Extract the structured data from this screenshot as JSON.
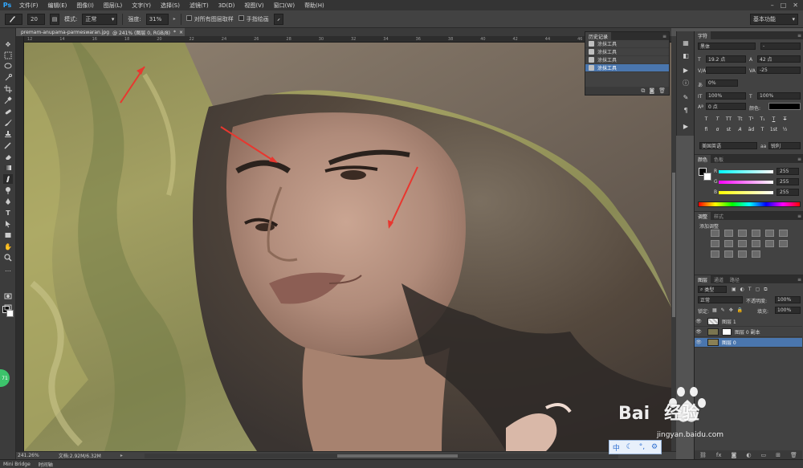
{
  "app": {
    "logo": "Ps"
  },
  "menu": [
    "文件(F)",
    "编辑(E)",
    "图像(I)",
    "图层(L)",
    "文字(Y)",
    "选择(S)",
    "滤镜(T)",
    "3D(D)",
    "视图(V)",
    "窗口(W)",
    "帮助(H)"
  ],
  "options_bar": {
    "size_value": "20",
    "mode_label": "模式:",
    "mode_value": "正常",
    "strength_label": "强度:",
    "strength_value": "31%",
    "sample_all_label": "对所有图层取样",
    "finger_paint_label": "手指绘画",
    "workspace": "基本功能"
  },
  "document": {
    "tab_name": "premam-anupama-parmeswaran.jpg",
    "tab_info": "@ 241% (图层 0, RGB/8)",
    "tab_mark": "*"
  },
  "ruler_ticks": [
    "12",
    "14",
    "16",
    "18",
    "20",
    "22",
    "24",
    "26",
    "28",
    "30",
    "32",
    "34",
    "36",
    "38",
    "40",
    "42",
    "44",
    "46",
    "48",
    "50"
  ],
  "status": {
    "zoom": "241.26%",
    "doc_size": "文档:2.92M/6.32M"
  },
  "bottom_tabs": [
    "Mini Bridge",
    "时间轴"
  ],
  "history_panel": {
    "title": "历史记录",
    "items": [
      "涂抹工具",
      "涂抹工具",
      "涂抹工具",
      "涂抹工具"
    ],
    "active_index": 3
  },
  "character_panel": {
    "tab": "字符",
    "font_family": "黑体",
    "font_style": "-",
    "font_size": "19.2 点",
    "leading": "42 点",
    "kerning_value": "-25",
    "tracking_value": "0%",
    "vscale": "100%",
    "hscale": "100%",
    "baseline": "0 点",
    "color_label": "颜色:",
    "style_glyphs": [
      "T",
      "T",
      "TT",
      "Tt",
      "T¹",
      "T₁",
      "T",
      "T"
    ],
    "extra_glyphs": [
      "fi",
      "σ",
      "st",
      "A",
      "ād",
      "T",
      "1st",
      "½"
    ],
    "language": "美国英语",
    "aa_label": "aa",
    "antialias": "锐利"
  },
  "color_panel": {
    "tabs": [
      "颜色",
      "色板"
    ],
    "channels": [
      {
        "label": "R",
        "value": "255"
      },
      {
        "label": "G",
        "value": "255"
      },
      {
        "label": "B",
        "value": "255"
      }
    ]
  },
  "adjustments_panel": {
    "tabs": [
      "调整",
      "样式"
    ],
    "heading": "添加调整"
  },
  "layers_panel": {
    "tabs": [
      "图层",
      "通道",
      "路径"
    ],
    "filter_kind": "类型",
    "blend_mode": "正常",
    "opacity_label": "不透明度:",
    "opacity": "100%",
    "lock_label": "锁定:",
    "fill_label": "填充:",
    "fill": "100%",
    "layers": [
      {
        "name": "图层 1"
      },
      {
        "name": "图层 0 副本"
      },
      {
        "name": "图层 0"
      }
    ],
    "active_index": 2
  },
  "side_badge": "71",
  "watermark": {
    "brand": "Bai",
    "brand_cn": "经验",
    "url": "jingyan.baidu.com"
  },
  "ime": {
    "label": "中"
  },
  "colors": {
    "accent": "#4a76ae",
    "annotation_arrow": "#e8372f",
    "ps_blue": "#31a8ff"
  }
}
